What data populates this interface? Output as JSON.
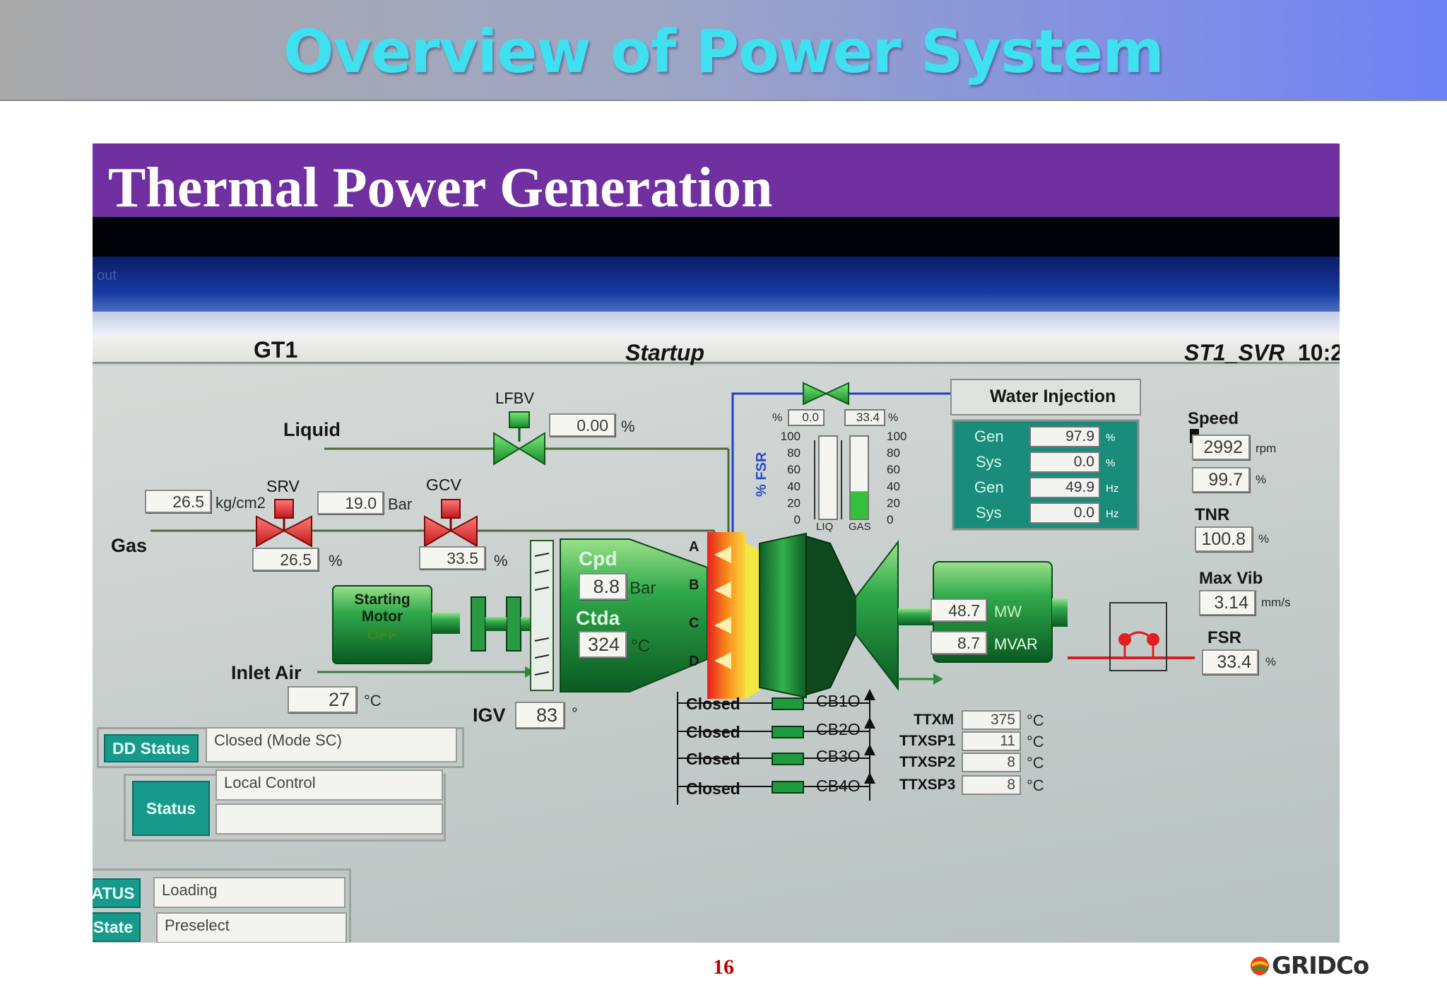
{
  "slide": {
    "title": "Overview of Power System",
    "section_title": "Thermal Power Generation",
    "page_number": "16",
    "brand": "GRIDCo"
  },
  "hmi": {
    "titlebar_fragment": "out",
    "unit_name": "GT1",
    "mode": "Startup",
    "station": "ST1_SVR",
    "time_fragment": "10:2",
    "fuel": {
      "liquid_label": "Liquid",
      "gas_label": "Gas",
      "lfbv_label": "LFBV",
      "lfbv_value": "0.00",
      "lfbv_unit": "%",
      "srv_label": "SRV",
      "srv_pressure": "26.5",
      "srv_pressure_unit": "kg/cm2",
      "srv_position": "26.5",
      "srv_position_unit": "%",
      "gcv_label": "GCV",
      "gcv_pressure": "19.0",
      "gcv_pressure_unit": "Bar",
      "gcv_position": "33.5",
      "gcv_position_unit": "%"
    },
    "starting_motor": {
      "label_line1": "Starting",
      "label_line2": "Motor",
      "state": "OFF"
    },
    "inlet_air": {
      "label": "Inlet Air",
      "value": "27",
      "unit": "°C"
    },
    "igv": {
      "label": "IGV",
      "value": "83",
      "unit": "°"
    },
    "compressor": {
      "cpd_label": "Cpd",
      "cpd_value": "8.8",
      "cpd_unit": "Bar",
      "ctda_label": "Ctda",
      "ctda_value": "324",
      "ctda_unit": "°C"
    },
    "combustor_rows": [
      "A",
      "B",
      "C",
      "D"
    ],
    "fsr_gauge": {
      "axis_label": "% FSR",
      "liq_label": "LIQ",
      "gas_label": "GAS",
      "liq_value": "0.0",
      "gas_value": "33.4",
      "unit": "%",
      "liq_fraction": 0.0,
      "gas_fraction": 0.334,
      "ticks": [
        "100",
        "80",
        "60",
        "40",
        "20",
        "0"
      ]
    },
    "water_injection": {
      "title": "Water Injection",
      "rows": [
        {
          "name": "Gen",
          "value": "97.9",
          "unit": "%"
        },
        {
          "name": "Sys",
          "value": "0.0",
          "unit": "%"
        },
        {
          "name": "Gen",
          "value": "49.9",
          "unit": "Hz"
        },
        {
          "name": "Sys",
          "value": "0.0",
          "unit": "Hz"
        }
      ]
    },
    "generator": {
      "mw_value": "48.7",
      "mw_unit": "MW",
      "mvar_value": "8.7",
      "mvar_unit": "MVAR"
    },
    "right_panel": {
      "speed_label": "Speed",
      "speed_rpm": "2992",
      "speed_rpm_unit": "rpm",
      "speed_pct": "99.7",
      "speed_pct_unit": "%",
      "tnr_label": "TNR",
      "tnr_value": "100.8",
      "tnr_unit": "%",
      "maxvib_label": "Max Vib",
      "maxvib_value": "3.14",
      "maxvib_unit": "mm/s",
      "fsr_label": "FSR",
      "fsr_value": "33.4",
      "fsr_unit": "%"
    },
    "breakers": [
      {
        "state": "Closed",
        "name": "CB1O"
      },
      {
        "state": "Closed",
        "name": "CB2O"
      },
      {
        "state": "Closed",
        "name": "CB3O"
      },
      {
        "state": "Closed",
        "name": "CB4O"
      }
    ],
    "exhaust_temps": [
      {
        "name": "TTXM",
        "value": "375",
        "unit": "°C"
      },
      {
        "name": "TTXSP1",
        "value": "11",
        "unit": "°C"
      },
      {
        "name": "TTXSP2",
        "value": "8",
        "unit": "°C"
      },
      {
        "name": "TTXSP3",
        "value": "8",
        "unit": "°C"
      }
    ],
    "status_panel": {
      "dd_status_label": "DD Status",
      "dd_status_value": "Closed (Mode SC)",
      "status_label": "Status",
      "status_value": "Local Control",
      "status_value2": ""
    },
    "lower_panel": {
      "status_label": "ATUS",
      "status_value": "Loading",
      "state_label": "State",
      "state_value": "Preselect"
    },
    "colors": {
      "banner_purple": "#7030a0",
      "title_cyan": "#3fe0f0",
      "equipment_green": "#1e8c38",
      "valve_red": "#e03030",
      "flame_orange": "#f08020",
      "panel_teal": "#179a8c",
      "page_number_red": "#c00000"
    }
  }
}
